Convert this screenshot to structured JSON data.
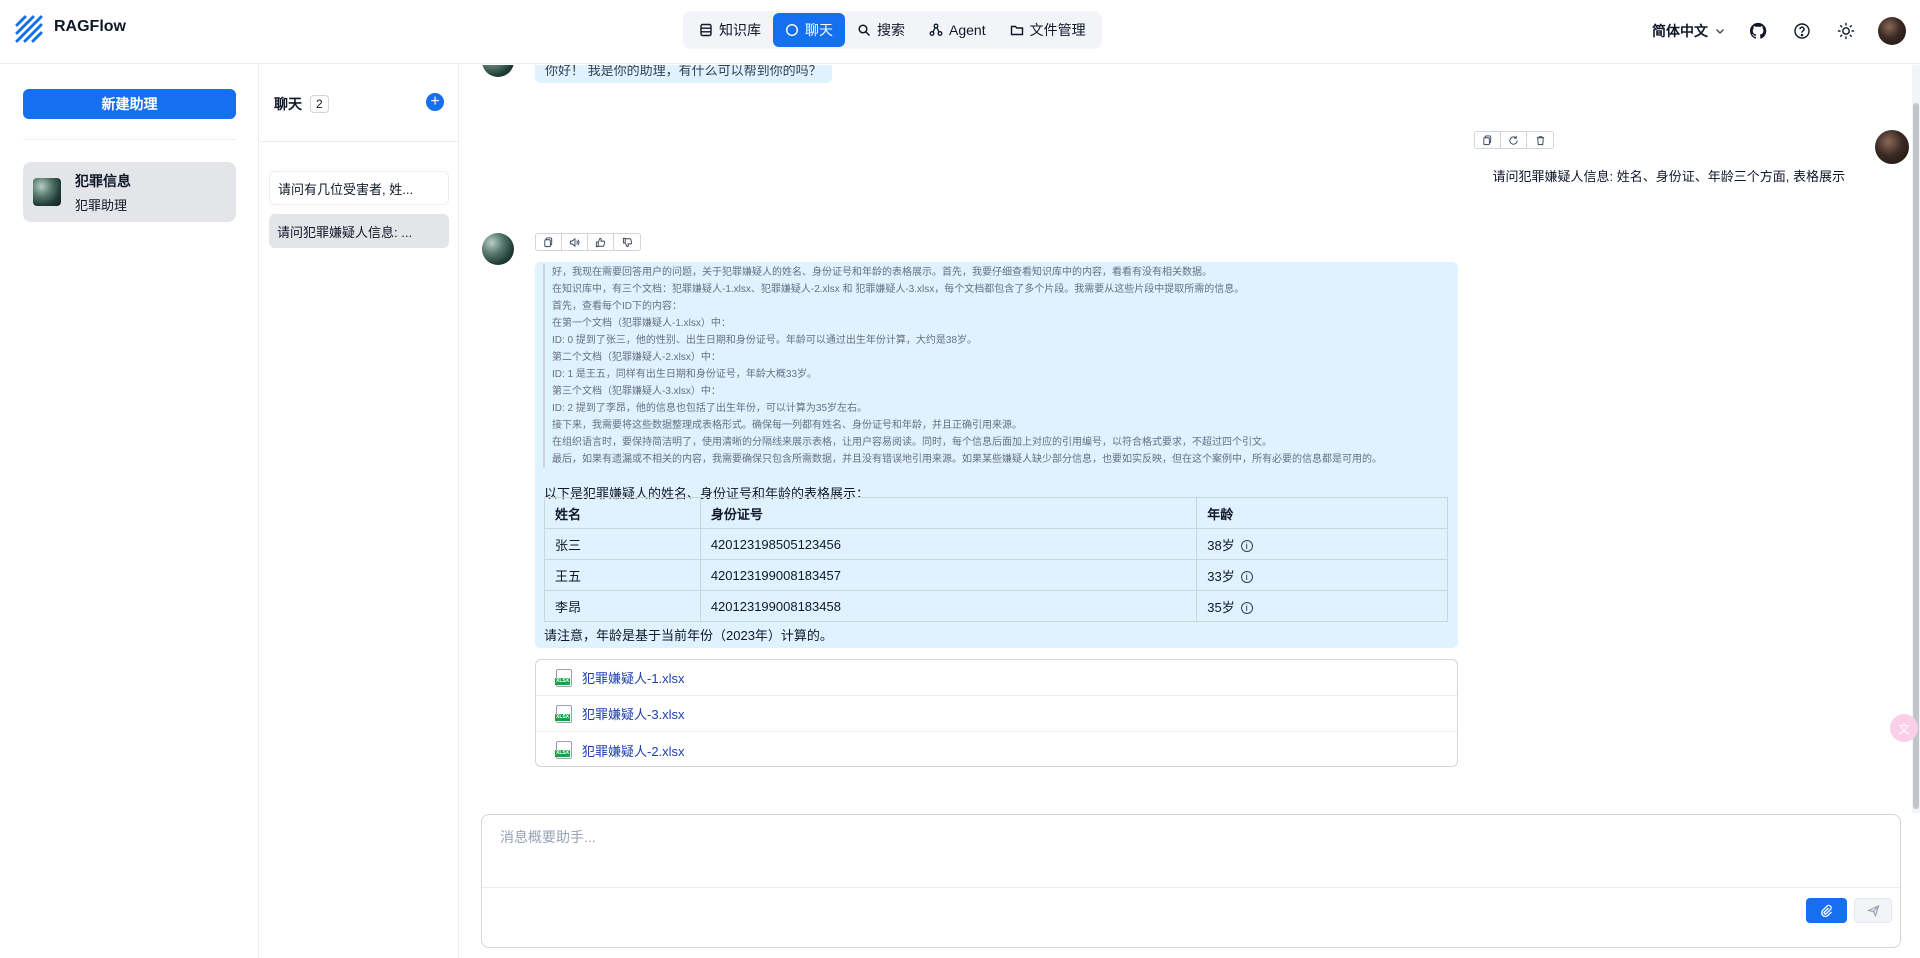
{
  "app": {
    "name": "RAGFlow"
  },
  "nav": {
    "items": [
      {
        "label": "知识库",
        "icon": "database-icon"
      },
      {
        "label": "聊天",
        "icon": "chat-icon",
        "active": true
      },
      {
        "label": "搜索",
        "icon": "search-icon"
      },
      {
        "label": "Agent",
        "icon": "agent-icon"
      },
      {
        "label": "文件管理",
        "icon": "folder-icon"
      }
    ]
  },
  "header_right": {
    "language": "简体中文"
  },
  "assistants": {
    "new_button": "新建助理",
    "items": [
      {
        "name": "犯罪信息",
        "description": "犯罪助理"
      }
    ]
  },
  "chats": {
    "title": "聊天",
    "count": "2",
    "items": [
      {
        "label": "请问有几位受害者, 姓..."
      },
      {
        "label": "请问犯罪嫌疑人信息: ..."
      }
    ]
  },
  "conversation": {
    "greeting": "你好！ 我是你的助理，有什么可以帮到你的吗？",
    "user_message": "请问犯罪嫌疑人信息: 姓名、身份证、年龄三个方面, 表格展示",
    "thinking": [
      "好，我现在需要回答用户的问题，关于犯罪嫌疑人的姓名、身份证号和年龄的表格展示。首先，我要仔细查看知识库中的内容，看看有没有相关数据。",
      "在知识库中，有三个文档：犯罪嫌疑人-1.xlsx、犯罪嫌疑人-2.xlsx 和 犯罪嫌疑人-3.xlsx，每个文档都包含了多个片段。我需要从这些片段中提取所需的信息。",
      "首先，查看每个ID下的内容：",
      "在第一个文档（犯罪嫌疑人-1.xlsx）中：",
      "ID: 0 提到了张三，他的性别、出生日期和身份证号。年龄可以通过出生年份计算，大约是38岁。",
      "第二个文档（犯罪嫌疑人-2.xlsx）中：",
      "ID: 1 是王五，同样有出生日期和身份证号，年龄大概33岁。",
      "第三个文档（犯罪嫌疑人-3.xlsx）中：",
      "ID: 2 提到了李昂，他的信息也包括了出生年份，可以计算为35岁左右。",
      "接下来，我需要将这些数据整理成表格形式。确保每一列都有姓名、身份证号和年龄，并且正确引用来源。",
      "在组织语言时，要保持简洁明了，使用清晰的分隔线来展示表格，让用户容易阅读。同时，每个信息后面加上对应的引用编号，以符合格式要求，不超过四个引文。",
      "最后，如果有遗漏或不相关的内容，我需要确保只包含所需数据，并且没有错误地引用来源。如果某些嫌疑人缺少部分信息，也要如实反映，但在这个案例中，所有必要的信息都是可用的。"
    ],
    "answer_intro": "以下是犯罪嫌疑人的姓名、身份证号和年龄的表格展示：",
    "table": {
      "headers": [
        "姓名",
        "身份证号",
        "年龄"
      ],
      "rows": [
        [
          "张三",
          "420123198505123456",
          "38岁"
        ],
        [
          "王五",
          "420123199008183457",
          "33岁"
        ],
        [
          "李昂",
          "420123199008183458",
          "35岁"
        ]
      ]
    },
    "answer_note": "请注意，年龄是基于当前年份（2023年）计算的。",
    "files": [
      {
        "name": "犯罪嫌疑人-1.xlsx",
        "badge": "XLSX"
      },
      {
        "name": "犯罪嫌疑人-3.xlsx",
        "badge": "XLSX"
      },
      {
        "name": "犯罪嫌疑人-2.xlsx",
        "badge": "XLSX"
      }
    ]
  },
  "composer": {
    "placeholder": "消息概要助手..."
  },
  "colors": {
    "accent": "#1570ef",
    "bubble": "#e0f2fe",
    "selected": "#e4e5e9"
  }
}
